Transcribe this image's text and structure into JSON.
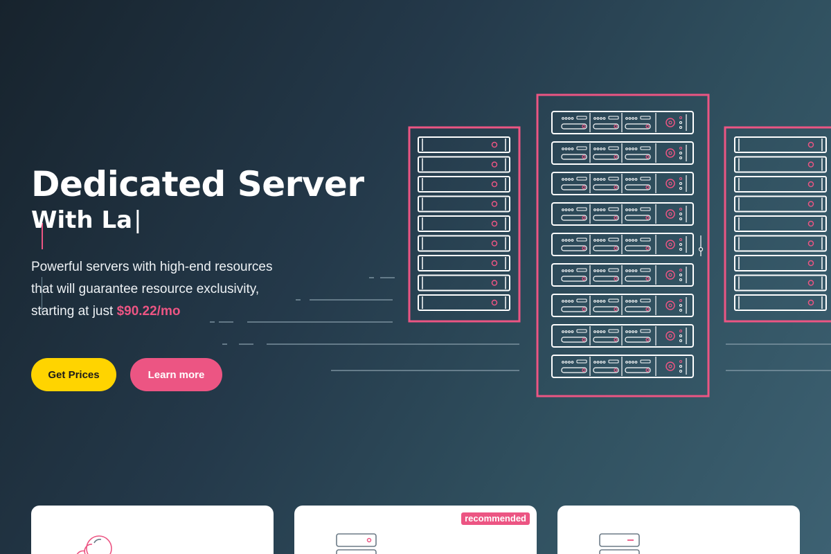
{
  "hero": {
    "title": "Dedicated Server",
    "subtitle": "With La",
    "caret": "|",
    "description_lines": [
      "Powerful servers with high-end resources",
      "that will guarantee resource exclusivity,",
      "starting at just "
    ],
    "price": "$90.22/mo"
  },
  "buttons": {
    "get_prices": "Get Prices",
    "learn_more": "Learn more"
  },
  "plan_cards": [
    {
      "icon": "cloud-icon",
      "badge": ""
    },
    {
      "icon": "server-icon",
      "badge": "recommended"
    },
    {
      "icon": "server-stack-icon",
      "badge": ""
    }
  ],
  "colors": {
    "accent_pink": "#ec5583",
    "accent_yellow": "#ffd400",
    "background_dark": "#17232d",
    "background_teal": "#3d6172"
  },
  "icons": [
    "server-rack-illustration",
    "cloud-icon",
    "server-icon",
    "server-stack-icon"
  ]
}
